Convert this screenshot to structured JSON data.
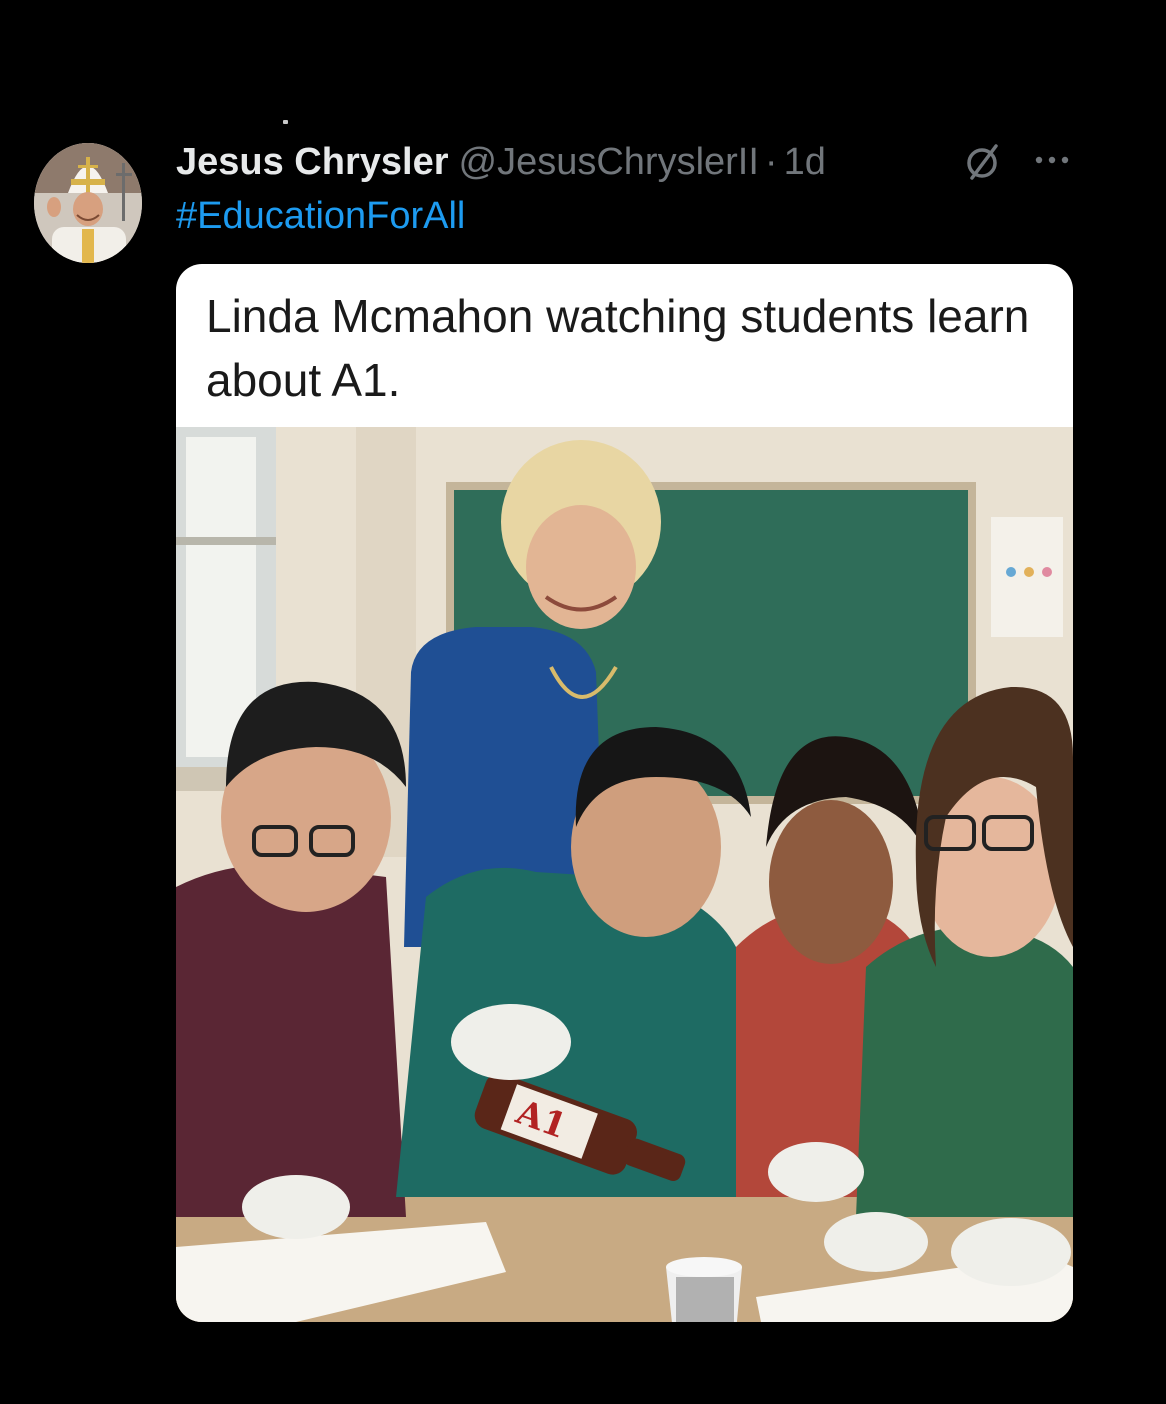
{
  "tweet": {
    "author": {
      "display_name": "Jesus Chrysler",
      "handle": "@JesusChryslerII",
      "avatar_icon": "avatar-photo-pope-costume"
    },
    "separator": "·",
    "time": "1d",
    "hashtag": "#EducationForAll",
    "actions": {
      "grok_icon": "slashed-circle-icon",
      "more_icon": "more-horizontal-icon"
    },
    "media": {
      "caption": "Linda Mcmahon watching students learn about A1."
    }
  },
  "colors": {
    "background": "#000000",
    "name": "#e7e9ea",
    "muted": "#71767b",
    "link": "#1d9bf0"
  }
}
